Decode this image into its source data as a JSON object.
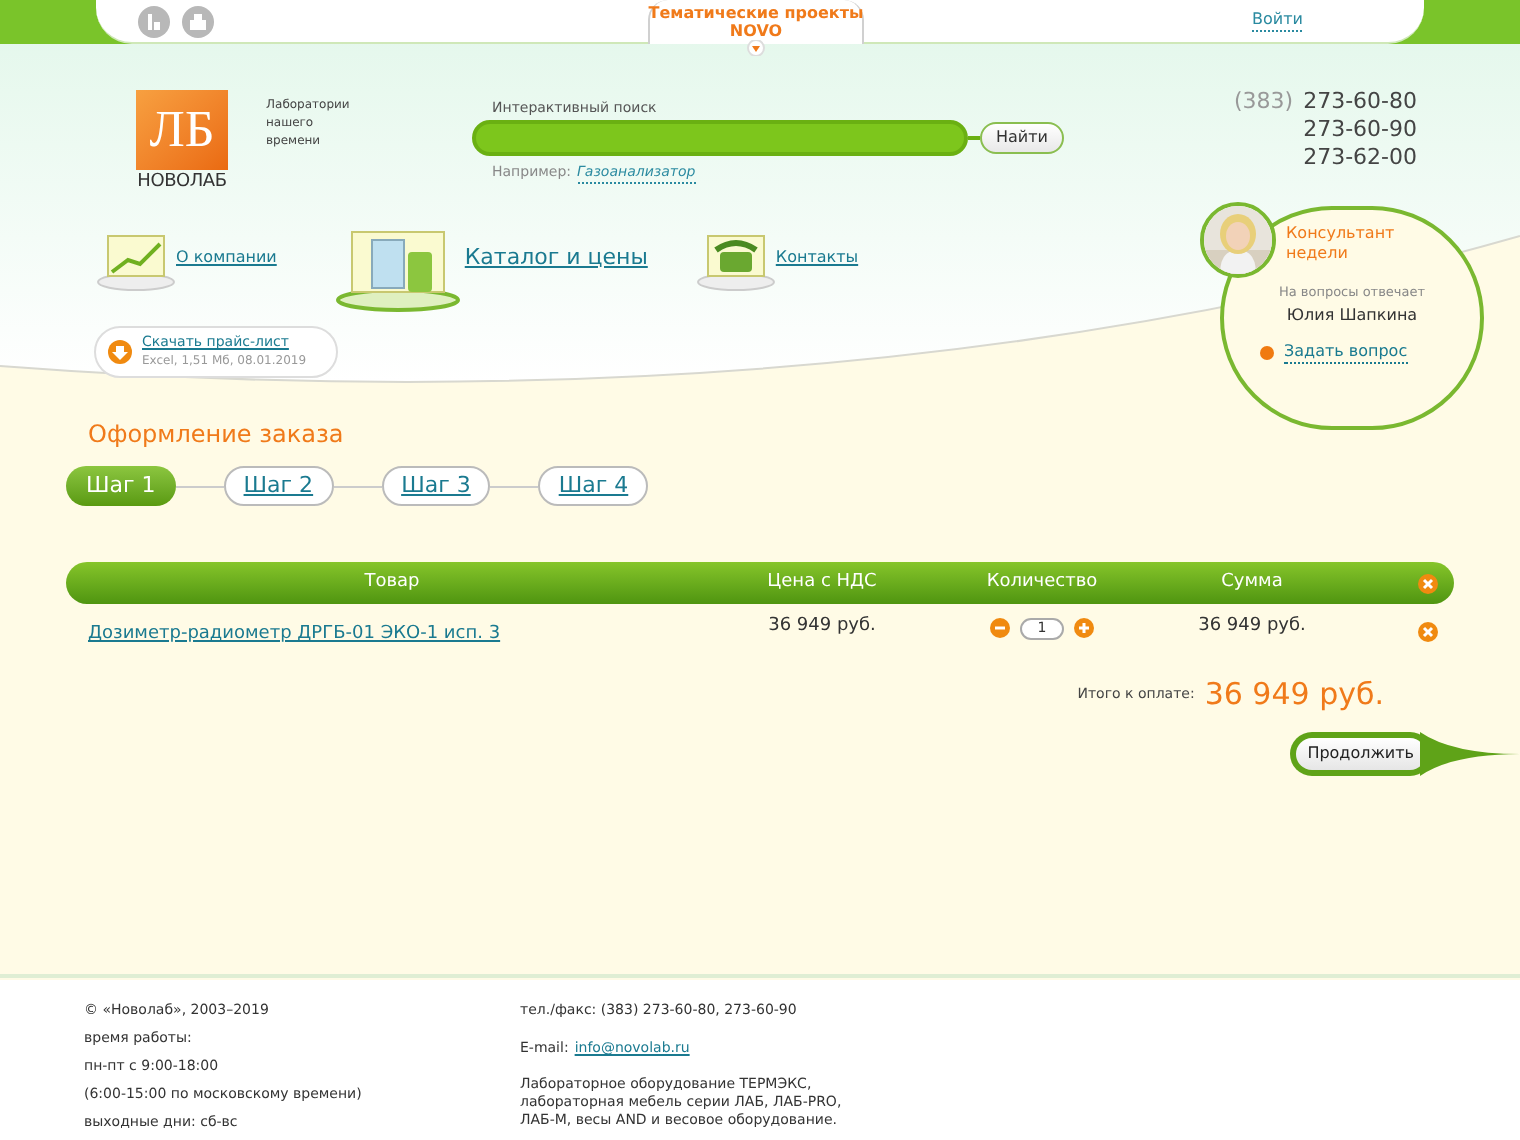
{
  "top_bar": {
    "projects_tab": {
      "title": "Тематические проекты",
      "subtitle": "NOVO"
    },
    "login": "Войти"
  },
  "logo": {
    "mark": "ЛБ",
    "name": "НОВОЛАБ"
  },
  "tagline": "Лаборатории нашего времени",
  "search": {
    "label": "Интерактивный поиск",
    "button": "Найти",
    "example_label": "Например:",
    "example_link": "Газоанализатор"
  },
  "phones": {
    "code": "(383)",
    "numbers": [
      "273-60-80",
      "273-60-90",
      "273-62-00"
    ]
  },
  "nav": [
    {
      "label": "О компании",
      "selected": false
    },
    {
      "label": "Каталог и цены",
      "selected": true
    },
    {
      "label": "Контакты",
      "selected": false
    }
  ],
  "price_list": {
    "link": "Скачать прайс-лист",
    "meta": "Excel, 1,51 Мб, 08.01.2019"
  },
  "consultant": {
    "title": "Консультант недели",
    "caption": "На вопросы отвечает",
    "name": "Юлия Шапкина",
    "ask_link": "Задать вопрос"
  },
  "order": {
    "title": "Оформление заказа",
    "steps": [
      {
        "label": "Шаг 1",
        "selected": true
      },
      {
        "label": "Шаг 2",
        "selected": false
      },
      {
        "label": "Шаг 3",
        "selected": false
      },
      {
        "label": "Шаг 4",
        "selected": false
      }
    ],
    "columns": [
      "Товар",
      "Цена с НДС",
      "Количество",
      "Сумма"
    ],
    "rows": [
      {
        "product": "Дозиметр-радиометр ДРГБ-01 ЭКО-1 исп. 3",
        "price": "36 949 руб.",
        "quantity": "1",
        "sum": "36 949 руб."
      }
    ],
    "total_label": "Итого к оплате:",
    "total": "36 949 руб.",
    "continue_button": "Продолжить"
  },
  "footer": {
    "left": [
      "© «Новолаб», 2003–2019",
      "время работы:",
      "пн-пт с 9:00-18:00",
      "(6:00-15:00 по московскому времени)",
      "выходные дни: сб-вс"
    ],
    "phone": "тел./факс: (383) 273-60-80, 273-60-90",
    "email_label": "E-mail:",
    "email": "info@novolab.ru",
    "description": "Лабораторное оборудование ТЕРМЭКС, лабораторная мебель серии ЛАБ, ЛАБ-PRO, ЛАБ-М, весы AND и весовое оборудование."
  }
}
